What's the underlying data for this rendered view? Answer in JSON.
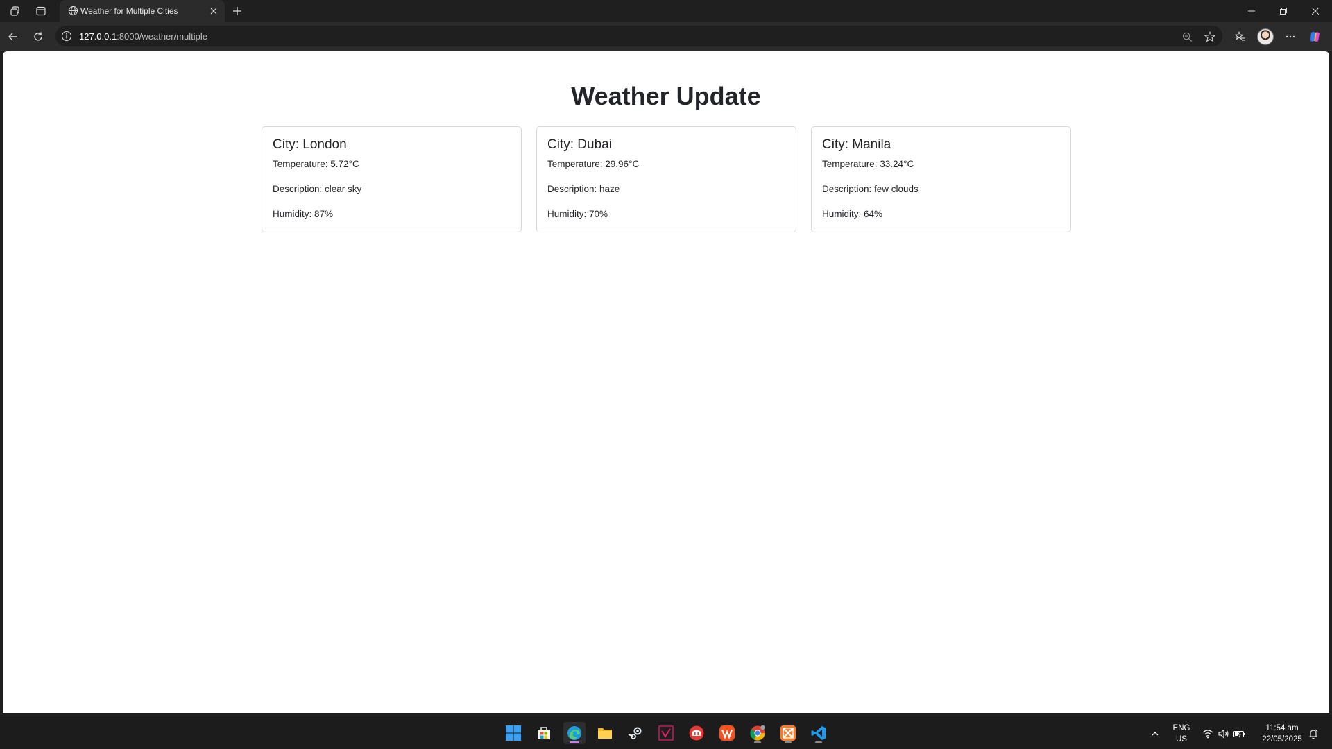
{
  "browser": {
    "tab_title": "Weather for Multiple Cities",
    "url_host": "127.0.0.1",
    "url_rest": ":8000/weather/multiple"
  },
  "page": {
    "title": "Weather Update",
    "cities": [
      {
        "city": "City: London",
        "temperature": "Temperature: 5.72°C",
        "description": "Description: clear sky",
        "humidity": "Humidity: 87%"
      },
      {
        "city": "City: Dubai",
        "temperature": "Temperature: 29.96°C",
        "description": "Description: haze",
        "humidity": "Humidity: 70%"
      },
      {
        "city": "City: Manila",
        "temperature": "Temperature: 33.24°C",
        "description": "Description: few clouds",
        "humidity": "Humidity: 64%"
      }
    ]
  },
  "taskbar": {
    "apps": [
      "start-icon",
      "store-icon",
      "edge-icon",
      "file-explorer-icon",
      "steam-icon",
      "app-icon",
      "app-icon",
      "app-icon",
      "chrome-icon",
      "xampp-icon",
      "vscode-icon"
    ],
    "language_line1": "ENG",
    "language_line2": "US",
    "time": "11:54 am",
    "date": "22/05/2025"
  },
  "colors": {
    "page_text": "#212529",
    "card_border": "#d7d7d7",
    "browser_chrome": "#2b2b2b"
  }
}
